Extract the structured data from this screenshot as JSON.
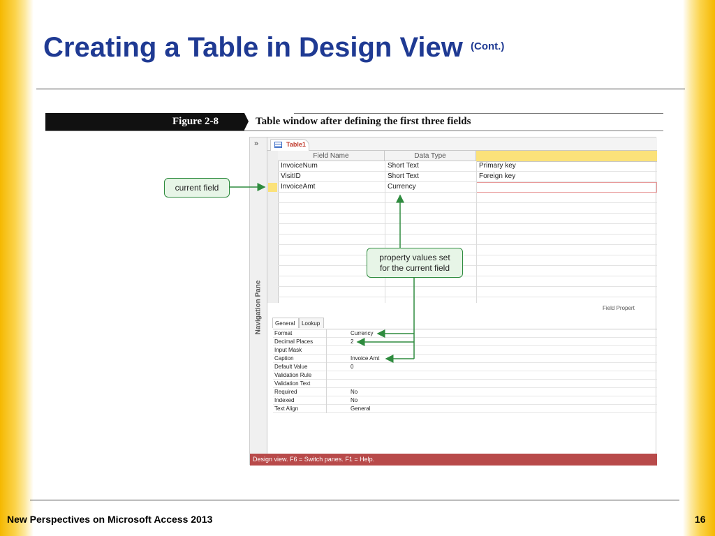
{
  "slide": {
    "title": "Creating a Table in Design View",
    "title_suffix": "(Cont.)",
    "footer": "New Perspectives on Microsoft Access 2013",
    "page_number": "16"
  },
  "figure": {
    "number": "Figure 2-8",
    "caption": "Table window after defining the first three fields"
  },
  "access_window": {
    "nav_pane_chevron": "»",
    "nav_pane_label": "Navigation Pane",
    "tab_label": "Table1",
    "columns": [
      "Field Name",
      "Data Type",
      ""
    ],
    "rows": [
      {
        "field_name": "InvoiceNum",
        "data_type": "Short Text",
        "description": "Primary key"
      },
      {
        "field_name": "VisitID",
        "data_type": "Short Text",
        "description": "Foreign key"
      },
      {
        "field_name": "InvoiceAmt",
        "data_type": "Currency",
        "description": ""
      }
    ],
    "field_properties_label": "Field Propert",
    "property_tabs": [
      "General",
      "Lookup"
    ],
    "properties": [
      {
        "name": "Format",
        "value": "Currency"
      },
      {
        "name": "Decimal Places",
        "value": "2"
      },
      {
        "name": "Input Mask",
        "value": ""
      },
      {
        "name": "Caption",
        "value": "Invoice Amt"
      },
      {
        "name": "Default Value",
        "value": "0"
      },
      {
        "name": "Validation Rule",
        "value": ""
      },
      {
        "name": "Validation Text",
        "value": ""
      },
      {
        "name": "Required",
        "value": "No"
      },
      {
        "name": "Indexed",
        "value": "No"
      },
      {
        "name": "Text Align",
        "value": "General"
      }
    ],
    "status_bar": "Design view.  F6 = Switch panes.  F1 = Help."
  },
  "callouts": {
    "current_field": "current field",
    "property_values_line1": "property values set",
    "property_values_line2": "for the current field"
  },
  "colors": {
    "title_blue": "#1f3a93",
    "callout_green": "#2e8b3e",
    "status_red": "#b84a4a",
    "highlight_yellow": "#fbe27a"
  }
}
